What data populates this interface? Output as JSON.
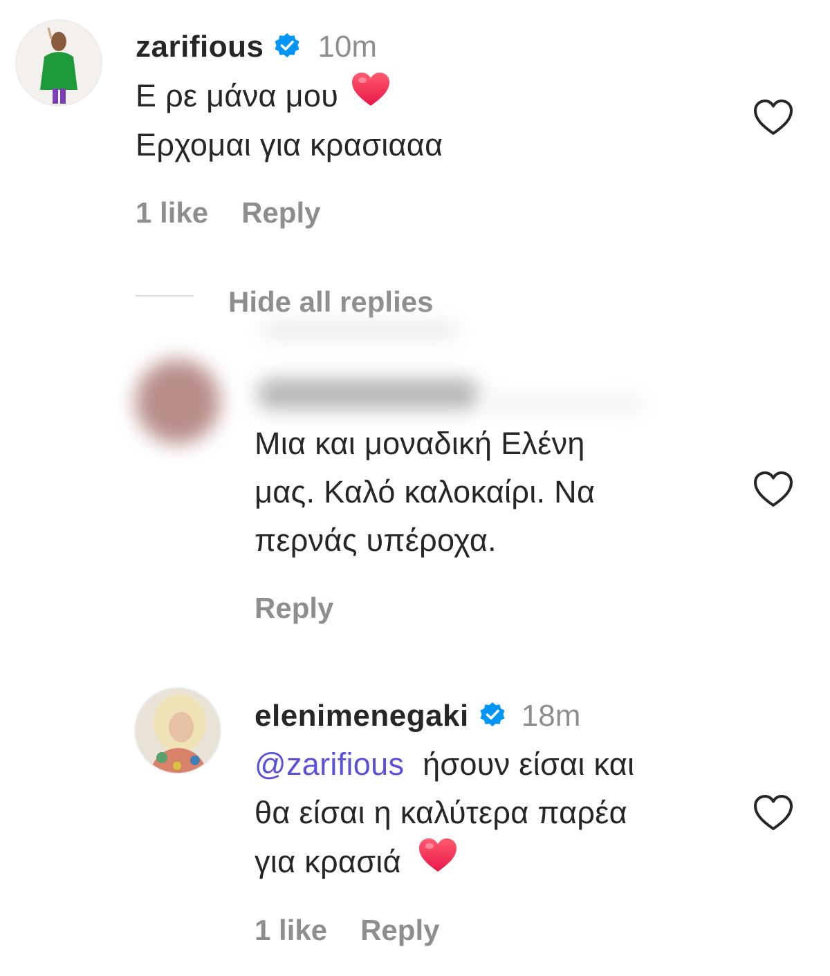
{
  "comments": [
    {
      "username": "zarifious",
      "verified": true,
      "time": "10m",
      "lines": [
        "Ε ρε μάνα μου",
        "Ερχομαι για κρασιααα"
      ],
      "likes": "1 like",
      "reply_label": "Reply",
      "hide_replies_label": "Hide all replies"
    },
    {
      "username": "",
      "verified": false,
      "lines": [
        "Μια και μοναδική Ελένη",
        "μας. Καλό καλοκαίρι. Να",
        "περνάς υπέροχα."
      ],
      "reply_label": "Reply"
    },
    {
      "username": "elenimenegaki",
      "verified": true,
      "time": "18m",
      "mention": "@zarifious",
      "lines": [
        "ήσουν είσαι και",
        "θα είσαι η καλύτερα παρέα",
        "για κρασιά"
      ],
      "likes": "1 like",
      "reply_label": "Reply"
    }
  ],
  "colors": {
    "text": "#262626",
    "secondary": "#8e8e8e",
    "verified": "#0095f6",
    "mention": "#5b51d8",
    "heart_emoji": "#f0245a"
  },
  "icons": [
    "heart-outline-icon",
    "verified-badge-icon",
    "heart-emoji-icon"
  ]
}
